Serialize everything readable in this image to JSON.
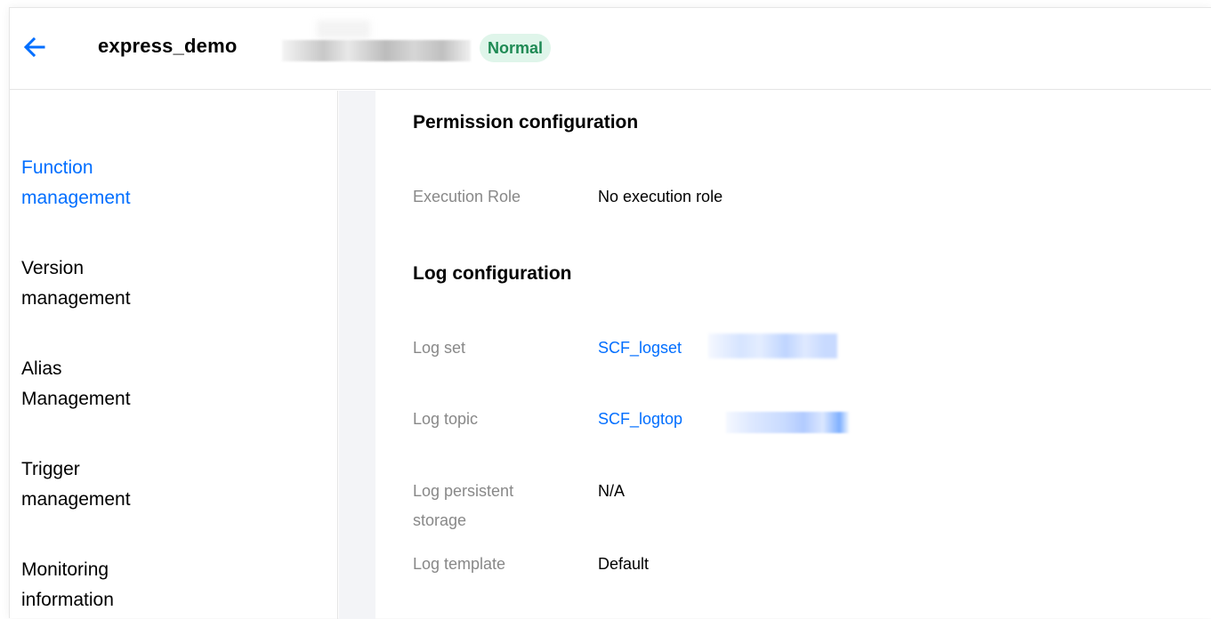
{
  "header": {
    "back_icon": "arrow-left-icon",
    "function_name": "express_demo",
    "status": "Normal"
  },
  "sidebar": {
    "items": [
      {
        "label": "Function\nmanagement",
        "active": true
      },
      {
        "label": "Version\nmanagement",
        "active": false
      },
      {
        "label": "Alias\nManagement",
        "active": false
      },
      {
        "label": "Trigger\nmanagement",
        "active": false
      },
      {
        "label": "Monitoring\ninformation",
        "active": false
      }
    ]
  },
  "permission": {
    "title": "Permission configuration",
    "execution_role_label": "Execution Role",
    "execution_role_value": "No execution role"
  },
  "log": {
    "title": "Log configuration",
    "log_set_label": "Log set",
    "log_set_value": "SCF_logset",
    "log_topic_label": "Log topic",
    "log_topic_value": "SCF_logtop",
    "persistent_label": "Log persistent\nstorage",
    "persistent_value": "N/A",
    "template_label": "Log template",
    "template_value": "Default"
  },
  "colors": {
    "accent": "#006eff",
    "status_bg": "#dff5ea",
    "status_text": "#1e8a54",
    "label": "#888888"
  }
}
